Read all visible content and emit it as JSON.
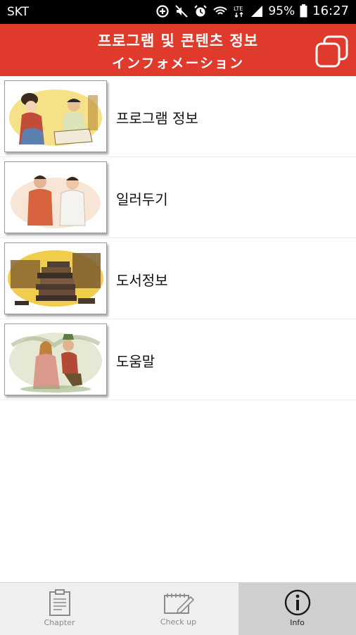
{
  "status_bar": {
    "carrier": "SKT",
    "battery": "95%",
    "time": "16:27",
    "icons": [
      "data-saver-icon",
      "mute-icon",
      "alarm-icon",
      "wifi-calling-icon",
      "lte-icon",
      "signal-icon",
      "battery-icon"
    ]
  },
  "header": {
    "title": "프로그램 및 콘텐츠 정보",
    "subtitle": "インフォメーション",
    "copy_icon": "copy-icon"
  },
  "list": {
    "items": [
      {
        "label": "프로그램 정보",
        "thumbnail": "couple-reading-illustration"
      },
      {
        "label": "일러두기",
        "thumbnail": "two-men-talking-illustration"
      },
      {
        "label": "도서정보",
        "thumbnail": "book-stacks-illustration"
      },
      {
        "label": "도움말",
        "thumbnail": "kneeling-couple-illustration"
      }
    ]
  },
  "bottom_nav": {
    "tabs": [
      {
        "label": "Chapter",
        "icon": "clipboard-icon",
        "active": false
      },
      {
        "label": "Check up",
        "icon": "notebook-pencil-icon",
        "active": false
      },
      {
        "label": "Info",
        "icon": "info-icon",
        "active": true
      }
    ]
  },
  "colors": {
    "header_bg": "#e03a2c",
    "status_bar_bg": "#000000",
    "active_tab_bg": "#cfcfcf",
    "nav_bg": "#efefef"
  }
}
